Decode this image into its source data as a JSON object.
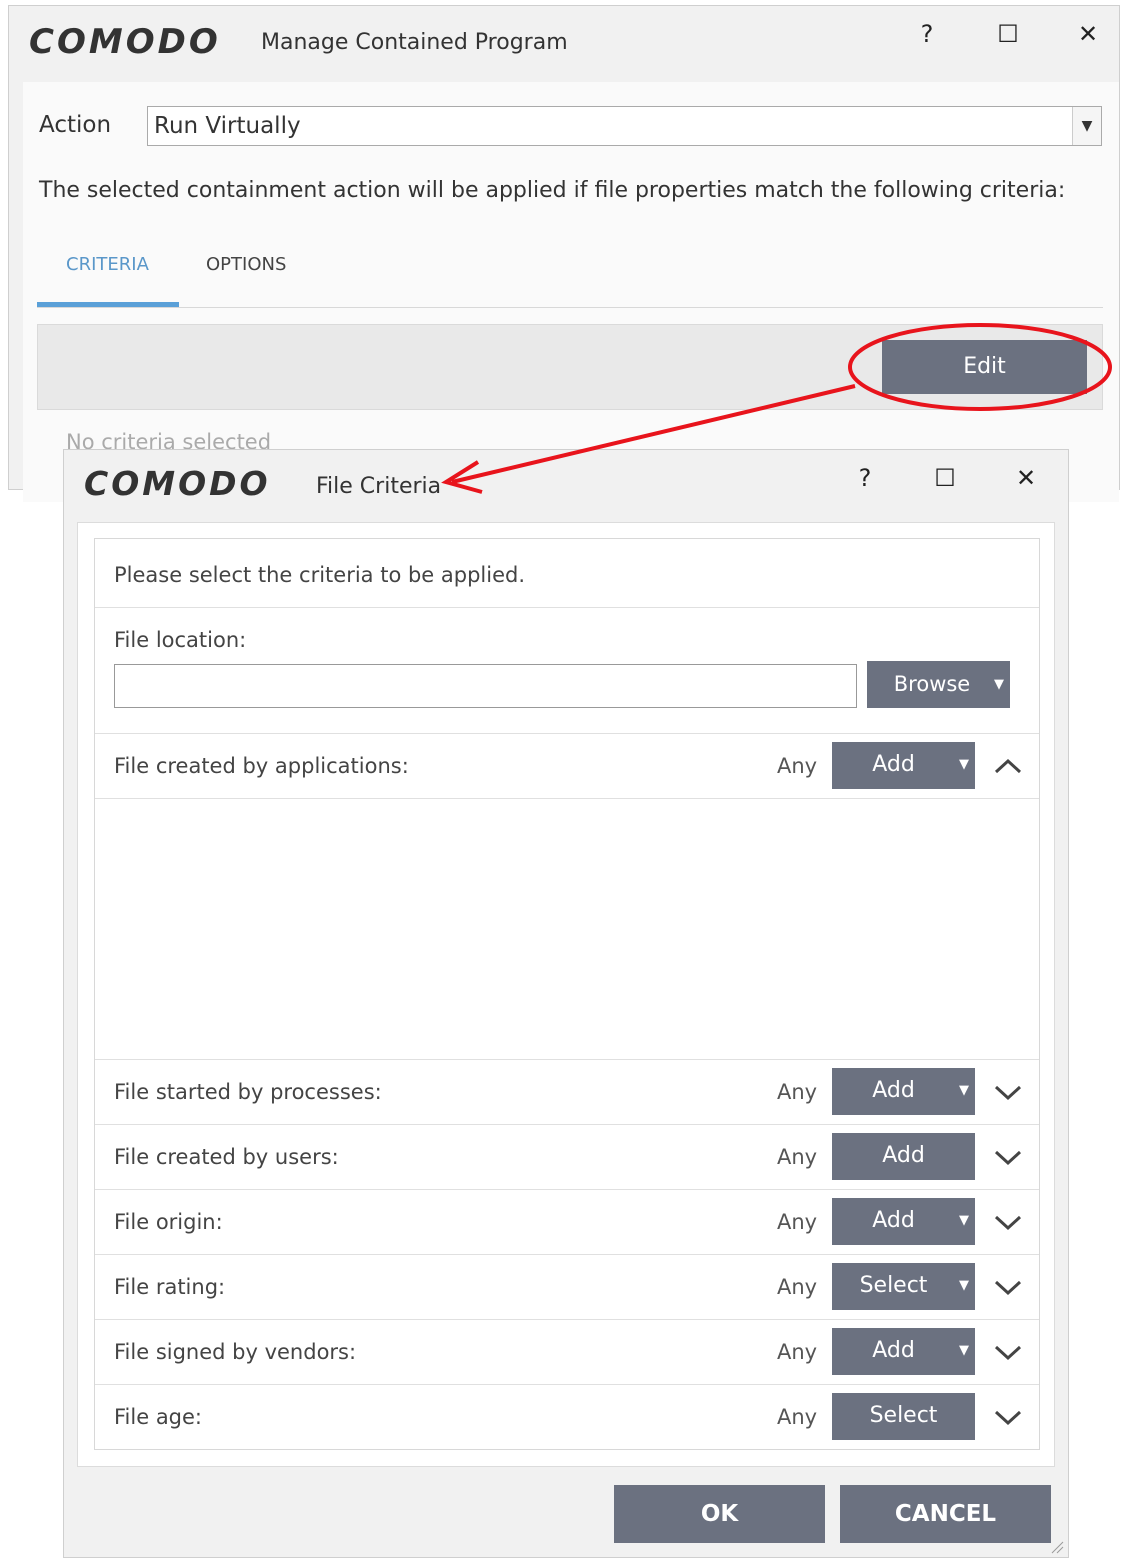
{
  "back_window": {
    "logo": "COMODO",
    "title": "Manage Contained Program",
    "controls": {
      "help": "?",
      "maximize": "☐",
      "close": "✕"
    },
    "action_label": "Action",
    "action_value": "Run Virtually",
    "criteria_text": "The selected containment action will be applied if file properties match the following criteria:",
    "tabs": [
      {
        "label": "CRITERIA",
        "active": true
      },
      {
        "label": "OPTIONS",
        "active": false
      }
    ],
    "edit_label": "Edit",
    "empty_text": "No criteria selected"
  },
  "dialog": {
    "logo": "COMODO",
    "title": "File Criteria",
    "controls": {
      "help": "?",
      "maximize": "☐",
      "close": "✕"
    },
    "instruction": "Please select the criteria to be applied.",
    "file_location": {
      "label": "File location:",
      "value": "",
      "browse_label": "Browse"
    },
    "criteria": [
      {
        "label": "File created by applications:",
        "any": "Any",
        "button": "Add",
        "dropdown": true,
        "expanded": true
      },
      {
        "label": "File started by processes:",
        "any": "Any",
        "button": "Add",
        "dropdown": true,
        "expanded": false
      },
      {
        "label": "File created by users:",
        "any": "Any",
        "button": "Add",
        "dropdown": false,
        "expanded": false
      },
      {
        "label": "File origin:",
        "any": "Any",
        "button": "Add",
        "dropdown": true,
        "expanded": false
      },
      {
        "label": "File rating:",
        "any": "Any",
        "button": "Select",
        "dropdown": true,
        "expanded": false
      },
      {
        "label": "File signed by vendors:",
        "any": "Any",
        "button": "Add",
        "dropdown": true,
        "expanded": false
      },
      {
        "label": "File age:",
        "any": "Any",
        "button": "Select",
        "dropdown": false,
        "expanded": false
      }
    ],
    "ok_label": "OK",
    "cancel_label": "CANCEL"
  },
  "colors": {
    "button_bg": "#6b7180",
    "tab_active": "#5a97c9",
    "annotation": "#e8141c"
  }
}
